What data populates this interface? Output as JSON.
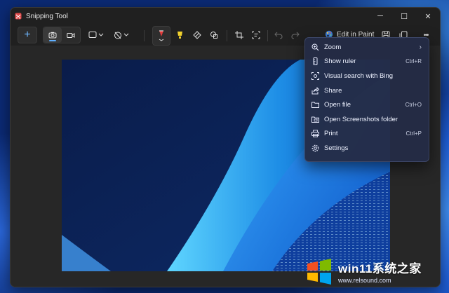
{
  "window": {
    "title": "Snipping Tool",
    "controls": {
      "minimize": "─",
      "maximize": "☐",
      "close": "✕"
    }
  },
  "toolbar": {
    "new_label": "+",
    "edit_in_paint_label": "Edit in Paint",
    "more_label": "•••"
  },
  "context_menu": {
    "items": [
      {
        "label": "Zoom",
        "shortcut": "",
        "submenu_arrow": "›",
        "icon": "zoom-icon"
      },
      {
        "label": "Show ruler",
        "shortcut": "Ctrl+R",
        "icon": "ruler-icon"
      },
      {
        "label": "Visual search with Bing",
        "shortcut": "",
        "icon": "visual-search-icon"
      },
      {
        "label": "Share",
        "shortcut": "",
        "icon": "share-icon"
      },
      {
        "label": "Open file",
        "shortcut": "Ctrl+O",
        "icon": "folder-icon"
      },
      {
        "label": "Open Screenshots folder",
        "shortcut": "",
        "icon": "screenshots-folder-icon"
      },
      {
        "label": "Print",
        "shortcut": "Ctrl+P",
        "icon": "printer-icon"
      },
      {
        "label": "Settings",
        "shortcut": "",
        "icon": "gear-icon"
      }
    ]
  },
  "watermark": {
    "title": "win11系统之家",
    "url": "www.relsound.com"
  },
  "colors": {
    "accent": "#60b0ff",
    "window_bg": "#202020",
    "menu_bg": "#242c46"
  }
}
